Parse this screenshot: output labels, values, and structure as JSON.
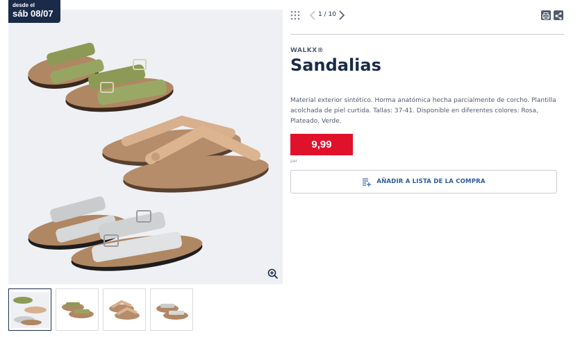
{
  "badge": {
    "line1": "desde el",
    "line2": "sáb 08/07"
  },
  "gallery": {
    "icons": {
      "zoom": "zoom-in-icon",
      "grid": "grid-icon",
      "prev": "chevron-left-icon",
      "next": "chevron-right-icon"
    },
    "counter": "1 / 10",
    "thumbnails": [
      {
        "variant": "all"
      },
      {
        "variant": "green"
      },
      {
        "variant": "rose"
      },
      {
        "variant": "silver"
      }
    ]
  },
  "toolbar": {
    "print_icon": "print-icon",
    "share_icon": "share-icon"
  },
  "product": {
    "brand": "WALKX®",
    "title": "Sandalias",
    "description": "Material exterior sintético. Horma anatómica hecha parcialmente de corcho. Plantilla acolchada de piel curtida. Tallas: 37-41. Disponible en diferentes colores: Rosa, Plateado, Verde.",
    "price": "9,99",
    "price_unit": "par",
    "add_to_list_label": "AÑADIR A LISTA DE LA COMPRA"
  },
  "colors": {
    "navy": "#1a2b49",
    "price_red": "#e0112b",
    "link_blue": "#2b5a9e",
    "sandal_green": "#8c9a56",
    "sandal_rose": "#d8b08e",
    "sandal_silver": "#c9cbcd",
    "cork": "#b08763"
  }
}
